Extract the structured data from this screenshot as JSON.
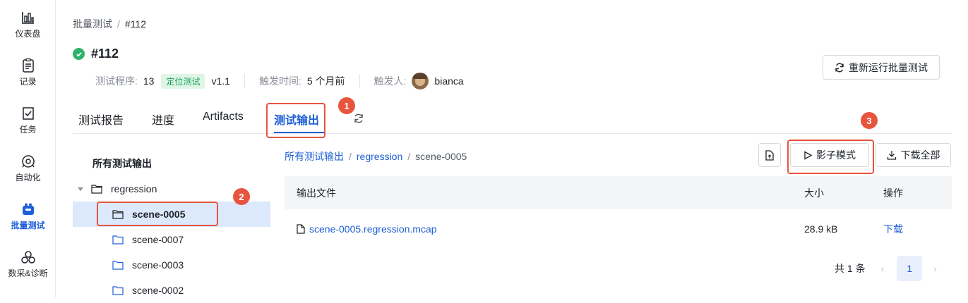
{
  "sidebar": {
    "items": [
      {
        "label": "仪表盘",
        "icon": "dashboard-icon"
      },
      {
        "label": "记录",
        "icon": "record-icon"
      },
      {
        "label": "任务",
        "icon": "task-icon"
      },
      {
        "label": "自动化",
        "icon": "automation-icon"
      },
      {
        "label": "批量测试",
        "icon": "batch-test-icon",
        "active": true
      },
      {
        "label": "数采&诊断",
        "icon": "diagnosis-icon"
      }
    ]
  },
  "breadcrumb": {
    "parent": "批量测试",
    "separator": "/",
    "current": "#112"
  },
  "title": "#112",
  "meta": {
    "program_label": "测试程序:",
    "program_value": "13",
    "program_tag": "定位测试",
    "program_version": "v1.1",
    "trigger_time_label": "触发时间:",
    "trigger_time_value": "5 个月前",
    "trigger_user_label": "触发人:",
    "trigger_user_value": "bianca"
  },
  "rerun_button": "重新运行批量测试",
  "tabs": [
    "测试报告",
    "进度",
    "Artifacts",
    "测试输出"
  ],
  "active_tab": "测试输出",
  "annotations": [
    "1",
    "2",
    "3"
  ],
  "tree": {
    "title": "所有测试输出",
    "root": "regression",
    "children": [
      "scene-0005",
      "scene-0007",
      "scene-0003",
      "scene-0002"
    ],
    "selected": "scene-0005"
  },
  "path": {
    "root": "所有测试输出",
    "parent": "regression",
    "current": "scene-0005",
    "separator": "/"
  },
  "actions": {
    "shadow_mode": "影子模式",
    "download_all": "下载全部"
  },
  "table": {
    "headers": [
      "输出文件",
      "大小",
      "操作"
    ],
    "rows": [
      {
        "file": "scene-0005.regression.mcap",
        "size": "28.9 kB",
        "action": "下载"
      }
    ]
  },
  "pagination": {
    "total_text": "共 1 条",
    "current_page": "1"
  },
  "colors": {
    "accent": "#1f5fd6",
    "success": "#2fb36b",
    "annotation": "#e8553f",
    "selected_row": "#dce8fb"
  }
}
